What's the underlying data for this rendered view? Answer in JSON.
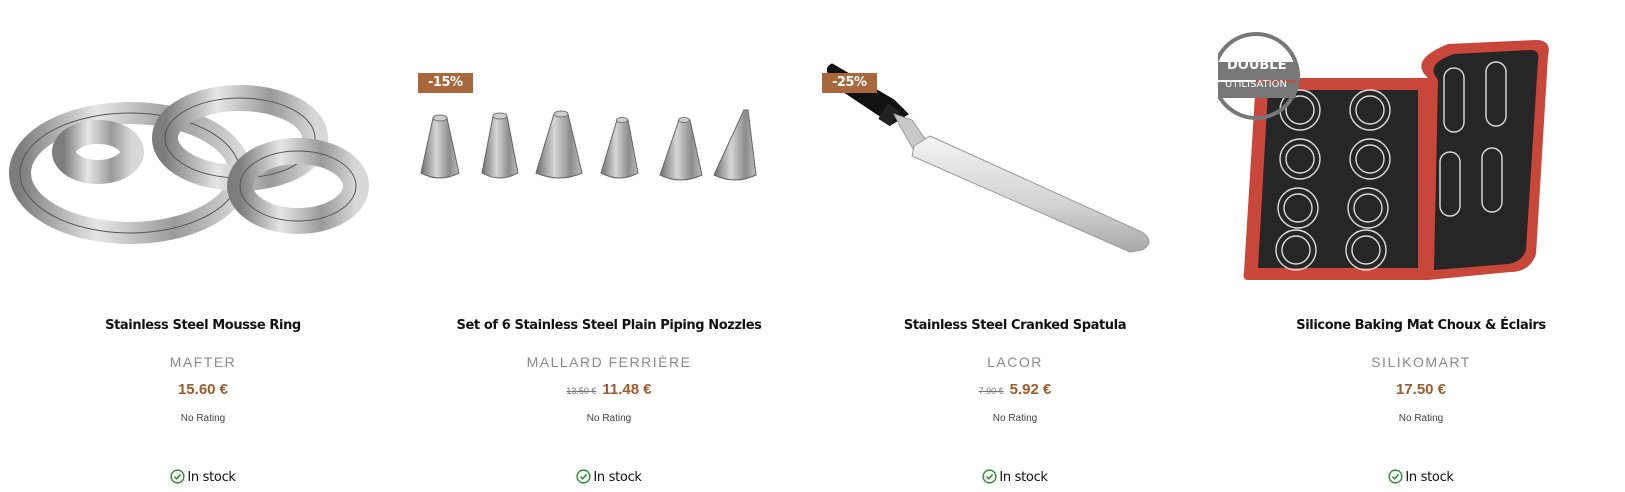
{
  "products": [
    {
      "title": "Stainless Steel Mousse Ring",
      "brand": "MAFTER",
      "old_price": "",
      "price": "15.60 €",
      "rating": "No Rating",
      "stock": "In stock",
      "badge": "",
      "image_icon": "mousse-rings-image"
    },
    {
      "title": "Set of 6 Stainless Steel Plain Piping Nozzles",
      "brand": "MALLARD FERRIÈRE",
      "old_price": "13.50 €",
      "price": "11.48 €",
      "rating": "No Rating",
      "stock": "In stock",
      "badge": "-15%",
      "image_icon": "piping-nozzles-image"
    },
    {
      "title": "Stainless Steel Cranked Spatula",
      "brand": "LACOR",
      "old_price": "7.90 €",
      "price": "5.92 €",
      "rating": "No Rating",
      "stock": "In stock",
      "badge": "-25%",
      "image_icon": "spatula-image"
    },
    {
      "title": "Silicone Baking Mat Choux & Éclairs",
      "brand": "SILIKOMART",
      "old_price": "",
      "price": "17.50 €",
      "rating": "No Rating",
      "stock": "In stock",
      "badge": "",
      "image_icon": "baking-mat-image",
      "image_stamp": [
        "DOUBLE",
        "UTILISATION"
      ]
    }
  ],
  "colors": {
    "badge_bg": "#a9683c",
    "price": "#9c5b2b",
    "stock_check": "#2e8b2e"
  }
}
